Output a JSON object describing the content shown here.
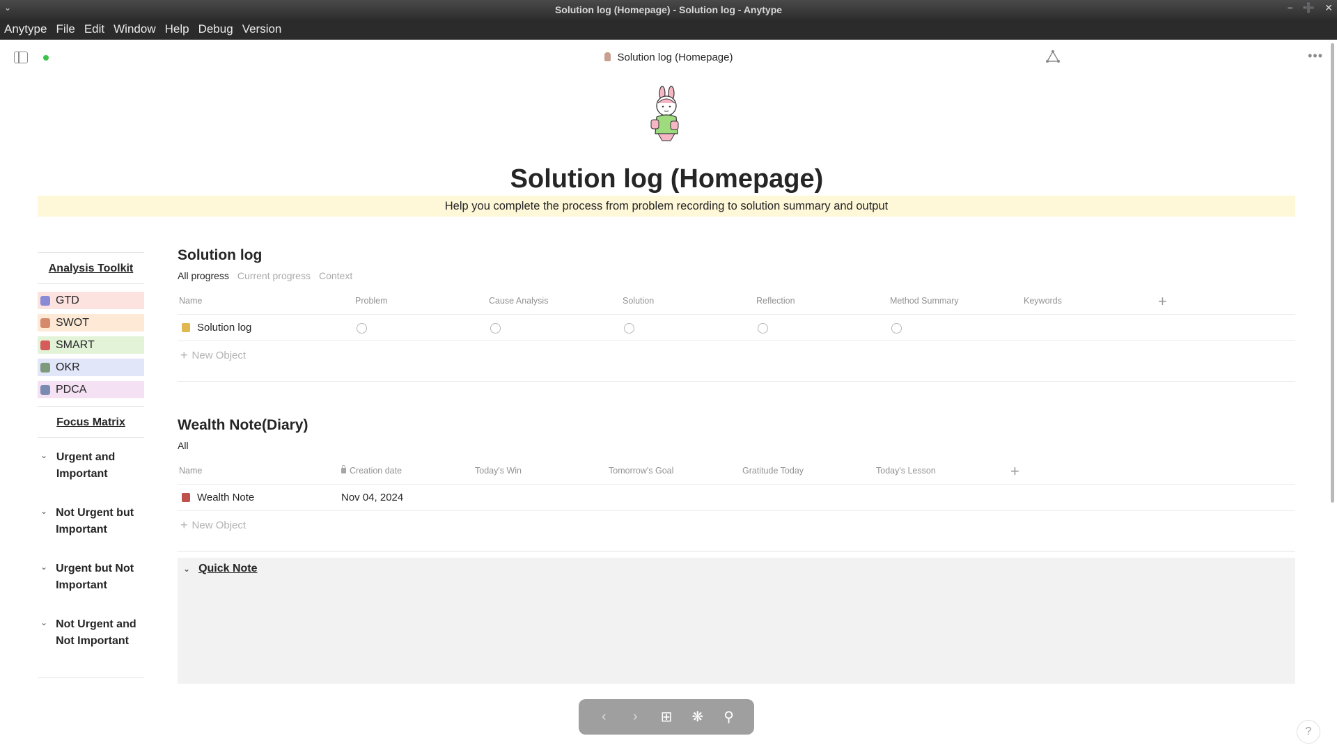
{
  "window": {
    "title": "Solution log (Homepage) - Solution log - Anytype",
    "menu": [
      "Anytype",
      "File",
      "Edit",
      "Window",
      "Help",
      "Debug",
      "Version"
    ]
  },
  "header": {
    "title": "Solution log (Homepage)"
  },
  "page": {
    "title": "Solution log (Homepage)",
    "description": "Help you complete the process from problem recording to solution summary and output",
    "accent_colors": {
      "callout": "#fef7d8",
      "sync": "#3cc34b"
    }
  },
  "toolkit": {
    "heading": "Analysis Toolkit",
    "items": [
      {
        "label": "GTD",
        "bg": "#fde3e0",
        "icon_color": "#8a8ad6"
      },
      {
        "label": "SWOT",
        "bg": "#fde9d6",
        "icon_color": "#d58a6e"
      },
      {
        "label": "SMART",
        "bg": "#e2f3d8",
        "icon_color": "#d65b5b"
      },
      {
        "label": "OKR",
        "bg": "#e1e6f8",
        "icon_color": "#7d9a7d"
      },
      {
        "label": "PDCA",
        "bg": "#f4e1f3",
        "icon_color": "#7a8ab0"
      }
    ]
  },
  "focus_matrix": {
    "heading": "Focus Matrix",
    "items": [
      {
        "label": "Urgent and Important"
      },
      {
        "label": "Not Urgent but Important"
      },
      {
        "label": "Urgent but Not Important"
      },
      {
        "label": "Not Urgent and Not Important"
      }
    ]
  },
  "solution_log": {
    "title": "Solution log",
    "views": [
      "All progress",
      "Current progress",
      "Context"
    ],
    "columns": [
      "Name",
      "Problem",
      "Cause Analysis",
      "Solution",
      "Reflection",
      "Method Summary",
      "Keywords"
    ],
    "rows": [
      {
        "name": "Solution log"
      }
    ],
    "new_object": "New Object"
  },
  "wealth_note": {
    "title": "Wealth Note(Diary)",
    "views": [
      "All"
    ],
    "columns": [
      "Name",
      "Creation date",
      "Today's Win",
      "Tomorrow's Goal",
      "Gratitude Today",
      "Today's Lesson"
    ],
    "rows": [
      {
        "name": "Wealth Note",
        "creation_date": "Nov 04, 2024"
      }
    ],
    "new_object": "New Object"
  },
  "quick_note": {
    "title": "Quick Note"
  },
  "navbar": {
    "icons": [
      "arrow-left",
      "arrow-right",
      "plus",
      "graph",
      "search"
    ]
  },
  "help": {
    "label": "?"
  }
}
